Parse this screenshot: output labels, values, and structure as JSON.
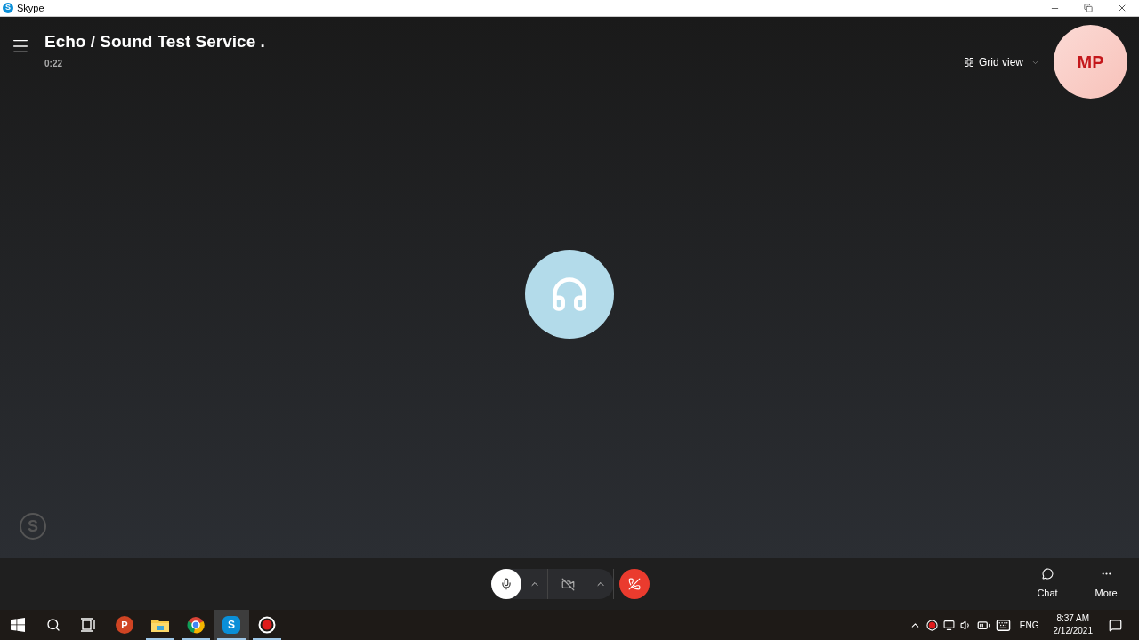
{
  "window": {
    "title": "Skype",
    "app_letter": "S"
  },
  "call": {
    "title": "Echo / Sound Test Service .",
    "duration": "0:22",
    "view_label": "Grid view",
    "self_initials": "MP",
    "watermark_letter": "S"
  },
  "controls": {
    "mic_on": true,
    "video_on": false
  },
  "side_actions": [
    {
      "kind": "chat",
      "label": "Chat"
    },
    {
      "kind": "more",
      "label": "More"
    }
  ],
  "taskbar": {
    "apps": [
      {
        "kind": "start",
        "selected": false
      },
      {
        "kind": "search",
        "selected": false
      },
      {
        "kind": "taskview",
        "selected": false
      },
      {
        "kind": "powerpoint",
        "letter": "P",
        "selected": false,
        "running": false
      },
      {
        "kind": "files",
        "selected": false,
        "running": true
      },
      {
        "kind": "chrome",
        "selected": false,
        "running": true
      },
      {
        "kind": "skype",
        "letter": "S",
        "selected": true,
        "running": true
      },
      {
        "kind": "recorder",
        "selected": false,
        "running": true
      }
    ],
    "language": "ENG",
    "time": "8:37 AM",
    "date": "2/12/2021"
  }
}
